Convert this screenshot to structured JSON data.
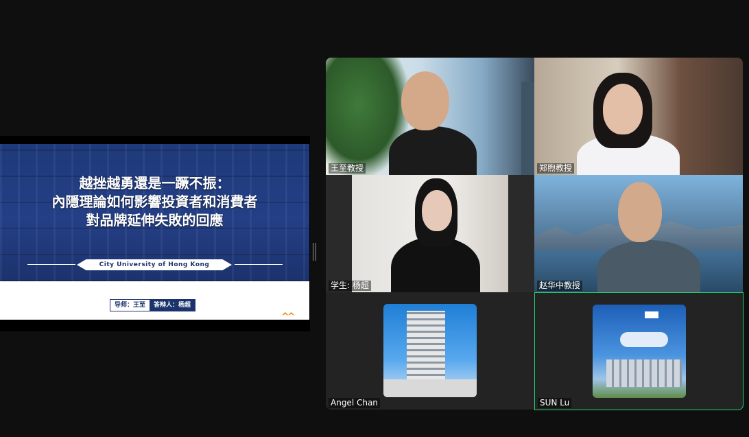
{
  "slide": {
    "title_lines": [
      "越挫越勇還是一蹶不振：",
      "內隱理論如何影響投資者和消費者",
      "對品牌延伸失敗的回應"
    ],
    "university": "City University of Hong Kong",
    "advisor": "导师：王至",
    "defender": "答辩人：杨超"
  },
  "participants": [
    {
      "name": "王至教授"
    },
    {
      "name": "郑煦教授"
    },
    {
      "name": "学生: 杨超"
    },
    {
      "name": "赵华中教授"
    },
    {
      "name": "Angel Chan"
    },
    {
      "name": "SUN Lu"
    }
  ],
  "colors": {
    "active_speaker_border": "#1fd36f",
    "slide_blue": "#1b326c",
    "accent_orange": "#f08a24"
  }
}
